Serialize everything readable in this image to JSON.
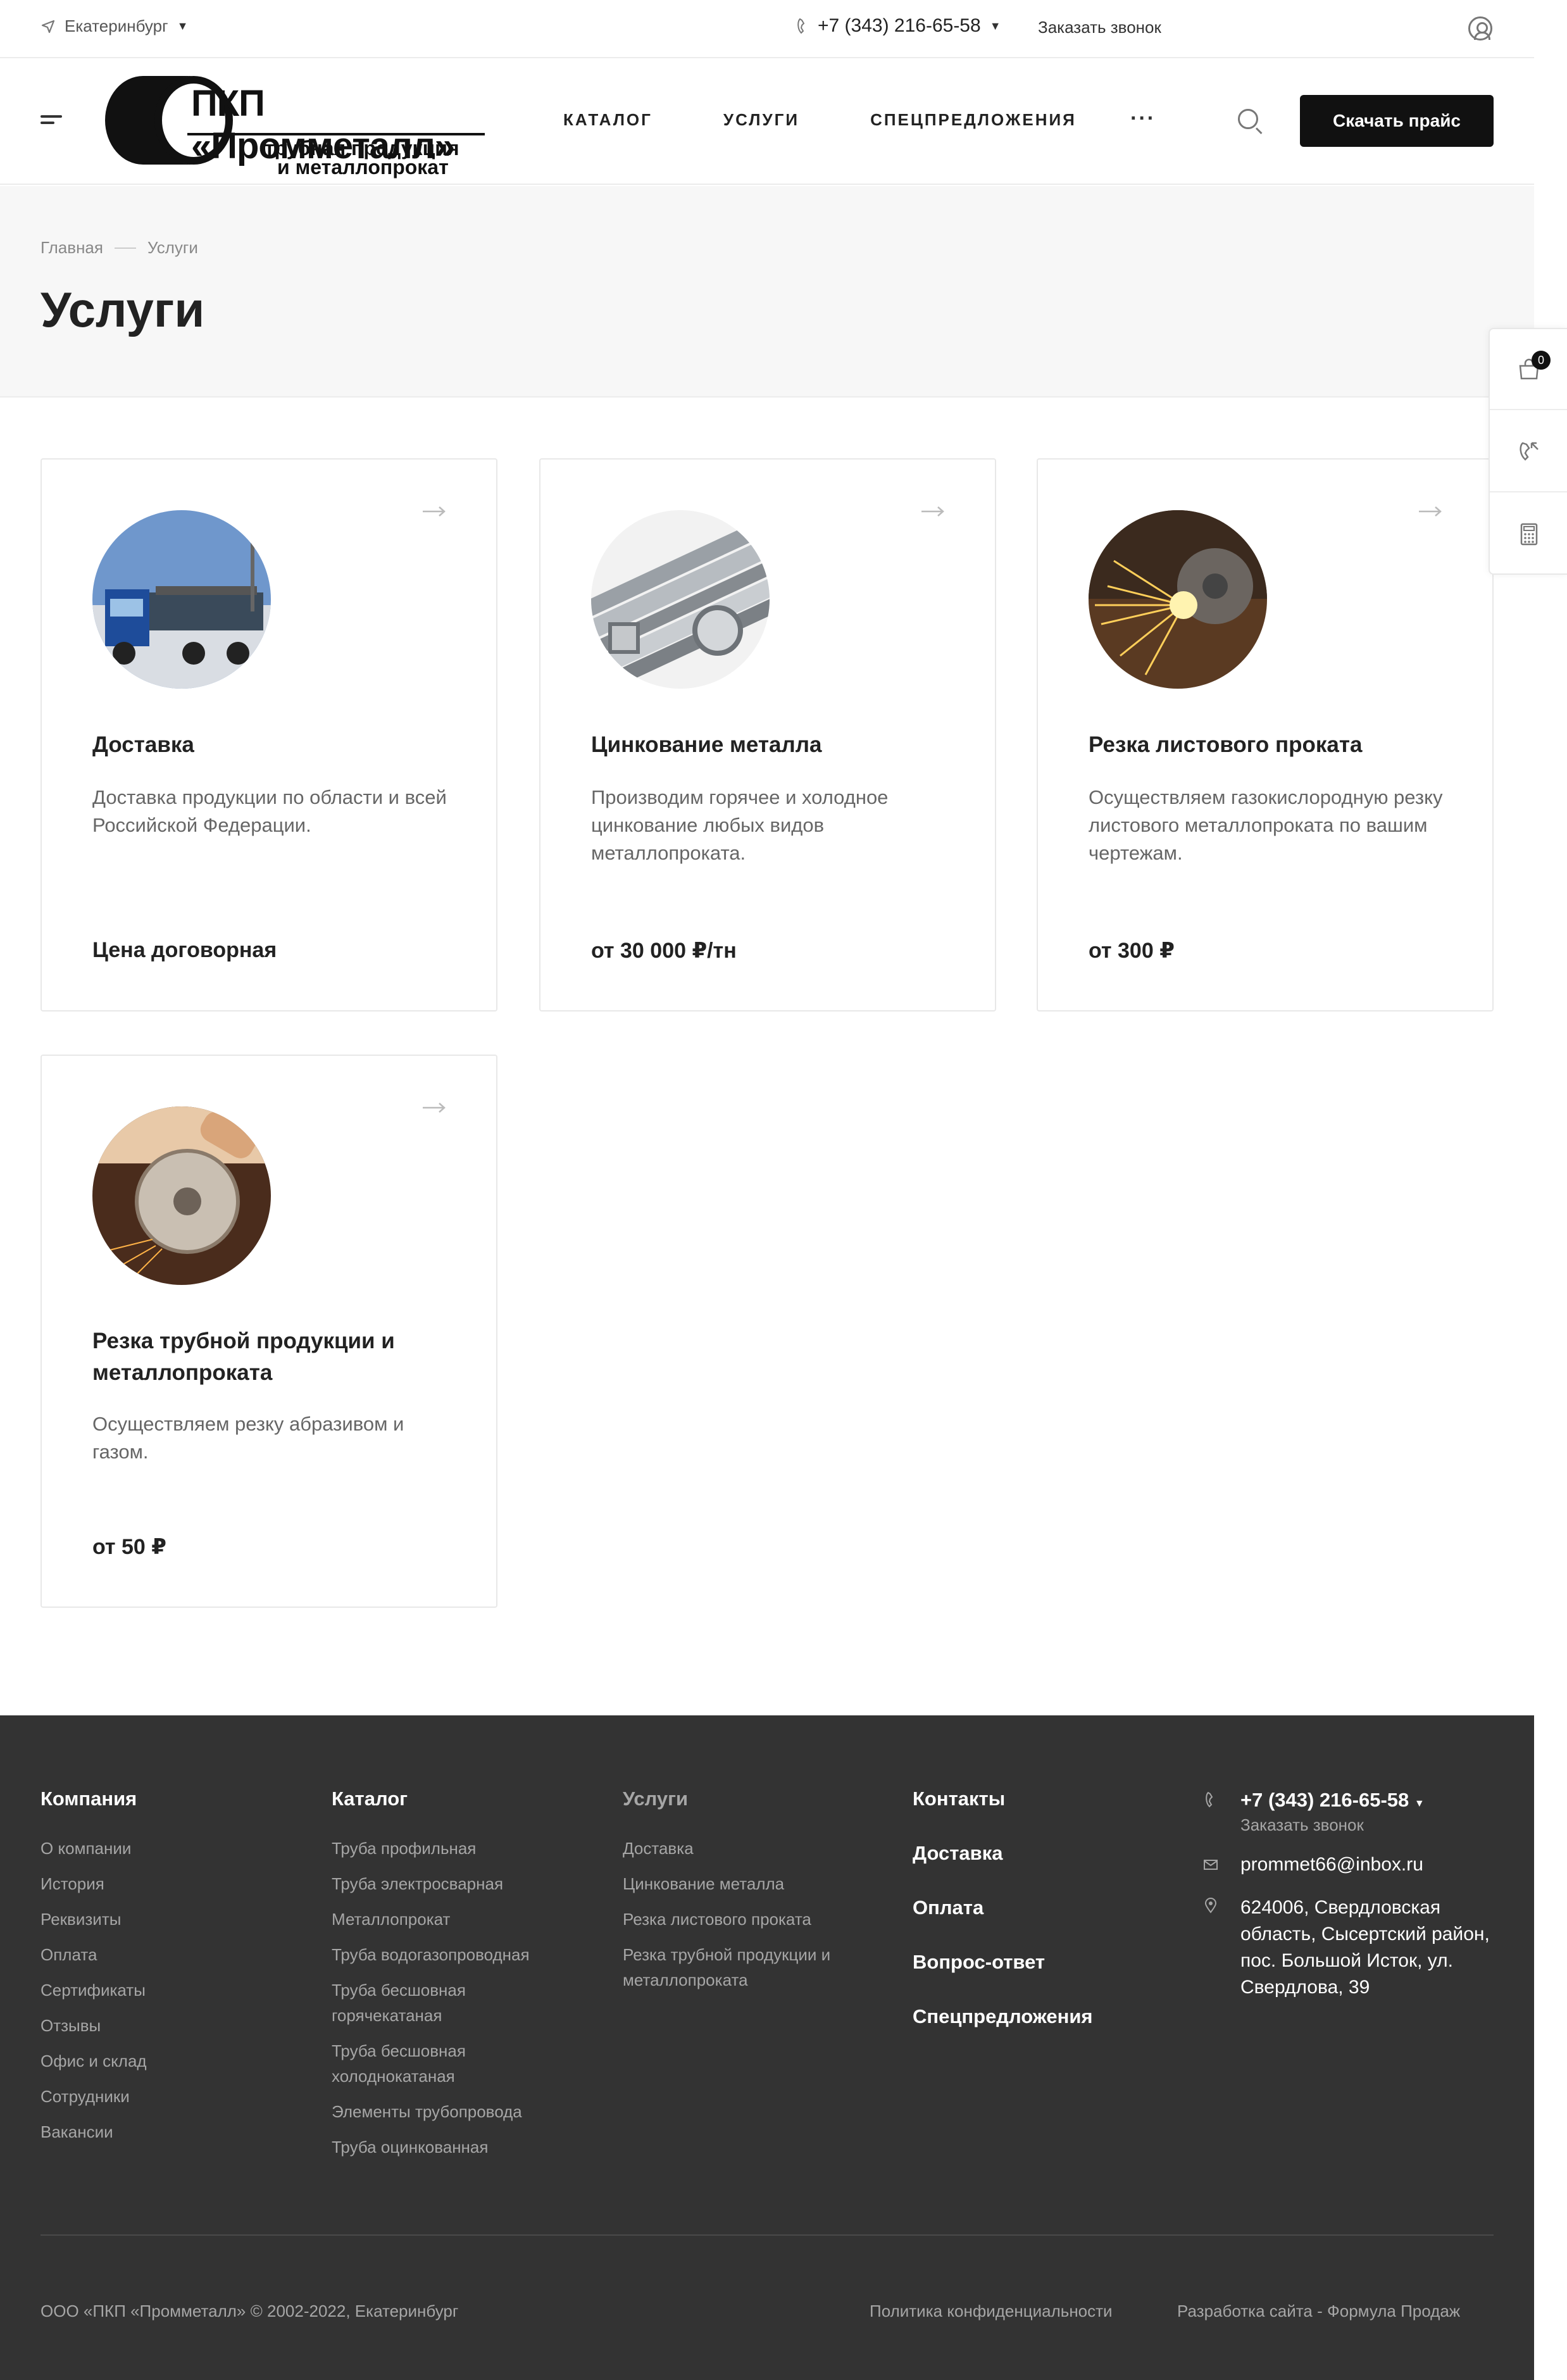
{
  "topbar": {
    "city": "Екатеринбург",
    "phone": "+7 (343) 216-65-58",
    "callback": "Заказать звонок"
  },
  "header": {
    "logo": {
      "name": "ПКП «Промметалл»",
      "tagline_1": "трубная продукция",
      "tagline_2": "и металлопрокат"
    },
    "nav": [
      "КАТАЛОГ",
      "УСЛУГИ",
      "СПЕЦПРЕДЛОЖЕНИЯ"
    ],
    "more": "···",
    "price_button": "Скачать прайс"
  },
  "hero": {
    "breadcrumb": [
      "Главная",
      "Услуги"
    ],
    "title": "Услуги"
  },
  "side_panel": {
    "cart_count": "0",
    "icons": [
      "cart-icon",
      "phone-callback-icon",
      "calculator-icon"
    ]
  },
  "cards": [
    {
      "title": "Доставка",
      "desc": "Доставка продукции по области и всей Российской Федерации.",
      "price": "Цена договорная",
      "image": "truck-image"
    },
    {
      "title": "Цинкование металла",
      "desc": "Производим горячее и холодное цинкование любых видов металлопроката.",
      "price": "от 30 000 ₽/тн",
      "image": "pipes-image"
    },
    {
      "title": "Резка листового проката",
      "desc": "Осуществляем газокислородную резку листового металлопроката по вашим чертежам.",
      "price": "от 300 ₽",
      "image": "sparks-image"
    },
    {
      "title": "Резка трубной продукции и металлопроката",
      "desc": "Осуществляем резку абразивом и газом.",
      "price": "от 50 ₽",
      "image": "grinder-image"
    }
  ],
  "footer": {
    "company": {
      "head": "Компания",
      "links": [
        "О компании",
        "История",
        "Реквизиты",
        "Оплата",
        "Сертификаты",
        "Отзывы",
        "Офис и склад",
        "Сотрудники",
        "Вакансии"
      ]
    },
    "catalog": {
      "head": "Каталог",
      "links": [
        "Труба профильная",
        "Труба электросварная",
        "Металлопрокат",
        "Труба водогазопроводная",
        "Труба бесшовная горячекатаная",
        "Труба бесшовная холоднокатаная",
        "Элементы трубопровода",
        "Труба оцинкованная"
      ]
    },
    "services": {
      "head": "Услуги",
      "links": [
        "Доставка",
        "Цинкование металла",
        "Резка листового проката",
        "Резка трубной продукции и металлопроката"
      ]
    },
    "info": [
      "Контакты",
      "Доставка",
      "Оплата",
      "Вопрос-ответ",
      "Спецпредложения"
    ],
    "contacts": {
      "phone": "+7 (343) 216-65-58",
      "callback": "Заказать звонок",
      "email": "prommet66@inbox.ru",
      "address": "624006, Свердловская область, Сысертский район, пос. Большой Исток, ул. Свердлова, 39"
    },
    "copyright": "ООО «ПКП «Промметалл» © 2002-2022, Екатеринбург",
    "privacy": "Политика конфиденциальности",
    "developer": "Разработка сайта - Формула Продаж"
  },
  "colors": {
    "primary_button": "#111111",
    "footer_bg": "#333333",
    "hero_bg": "#f7f7f7",
    "muted_text": "#a6a6a6"
  }
}
